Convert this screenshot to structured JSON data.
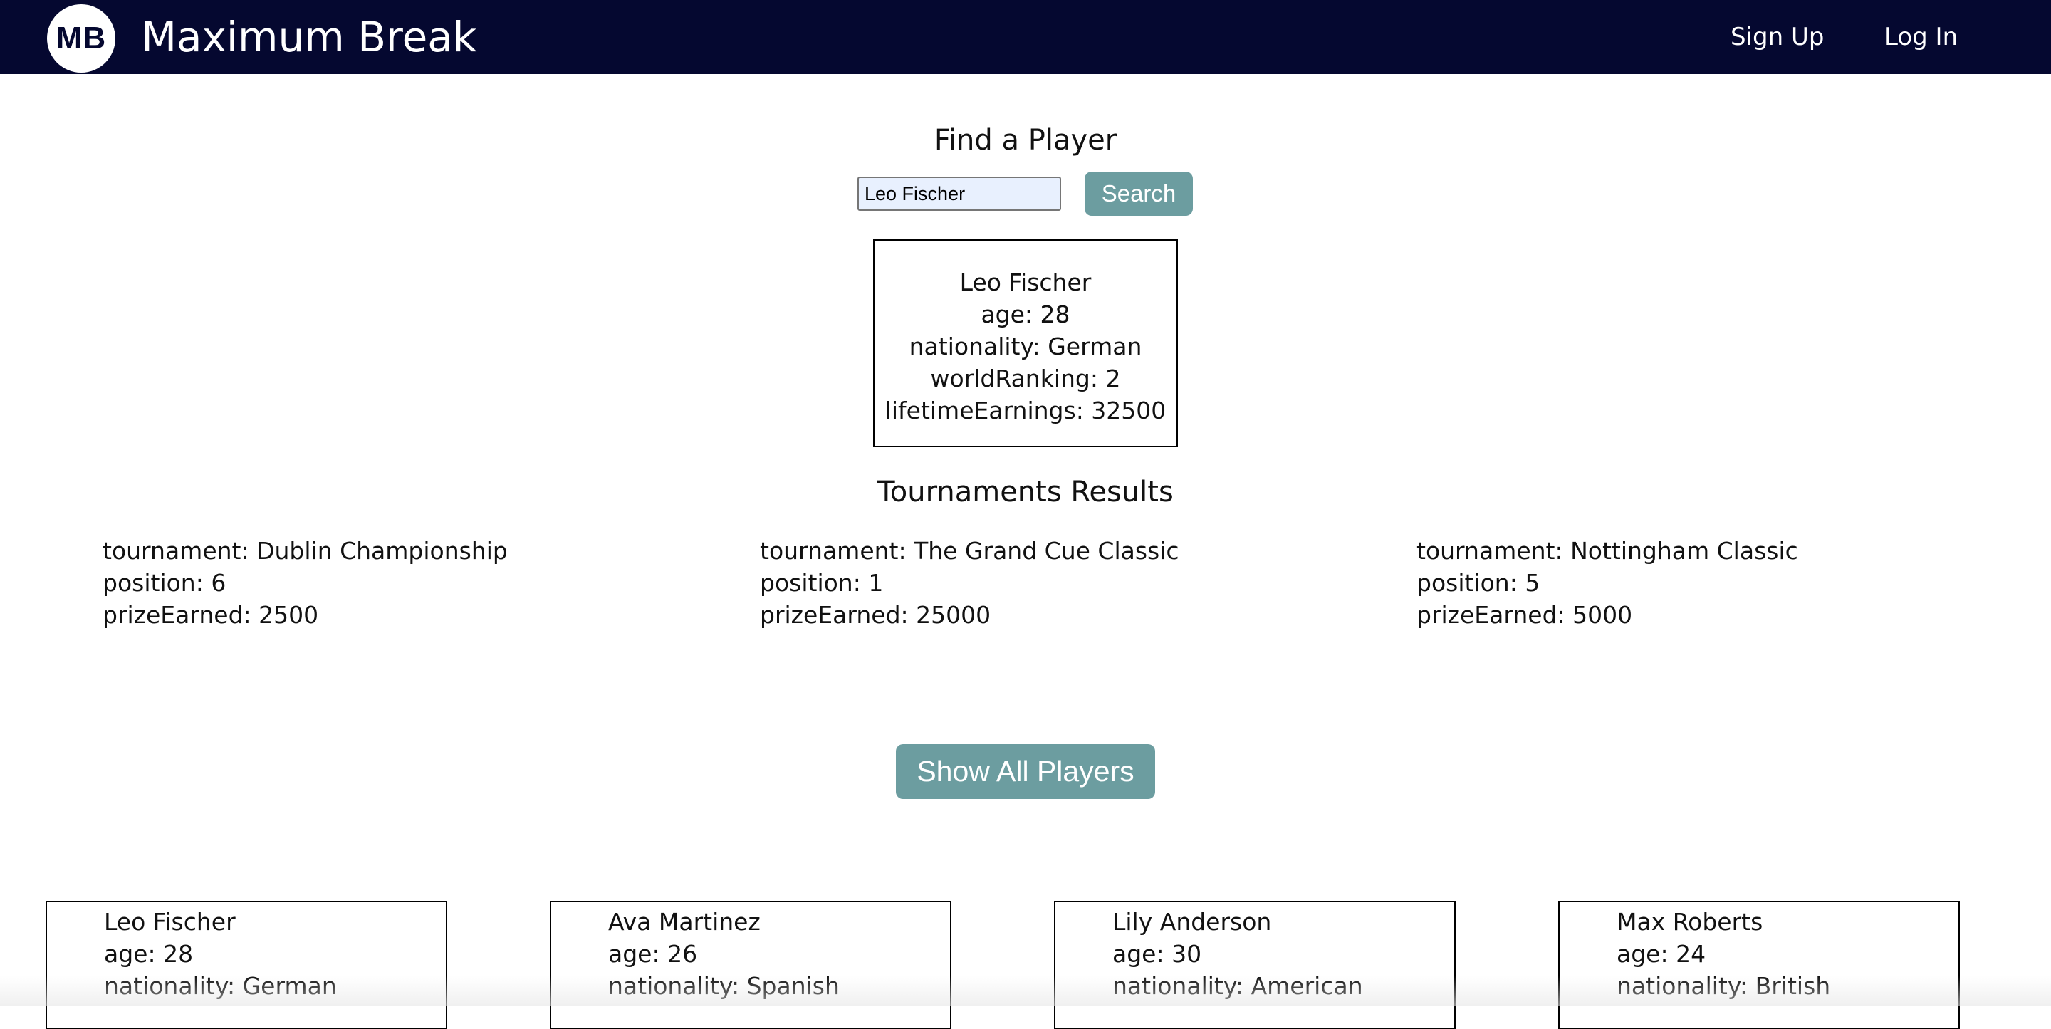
{
  "header": {
    "logo_text": "MB",
    "brand": "Maximum Break",
    "signup_label": "Sign Up",
    "login_label": "Log In"
  },
  "search": {
    "title": "Find a Player",
    "value": "Leo Fischer",
    "button_label": "Search"
  },
  "player": {
    "name": "Leo Fischer",
    "age": "age: 28",
    "nationality": "nationality: German",
    "world_ranking": "worldRanking: 2",
    "lifetime_earnings": "lifetimeEarnings: 32500"
  },
  "results": {
    "title": "Tournaments Results",
    "items": [
      {
        "tournament": "tournament: Dublin Championship",
        "position": "position: 6",
        "prize": "prizeEarned: 2500"
      },
      {
        "tournament": "tournament: The Grand Cue Classic",
        "position": "position: 1",
        "prize": "prizeEarned: 25000"
      },
      {
        "tournament": "tournament: Nottingham Classic",
        "position": "position: 5",
        "prize": "prizeEarned: 5000"
      }
    ]
  },
  "show_all": {
    "button_label": "Show All Players"
  },
  "players": [
    {
      "name": "Leo Fischer",
      "age": "age: 28",
      "nationality": "nationality: German"
    },
    {
      "name": "Ava Martinez",
      "age": "age: 26",
      "nationality": "nationality: Spanish"
    },
    {
      "name": "Lily Anderson",
      "age": "age: 30",
      "nationality": "nationality: American"
    },
    {
      "name": "Max Roberts",
      "age": "age: 24",
      "nationality": "nationality: British"
    }
  ],
  "colors": {
    "navbar": "#050830",
    "button": "#6c9da0",
    "input_background": "#e8f0fe"
  }
}
